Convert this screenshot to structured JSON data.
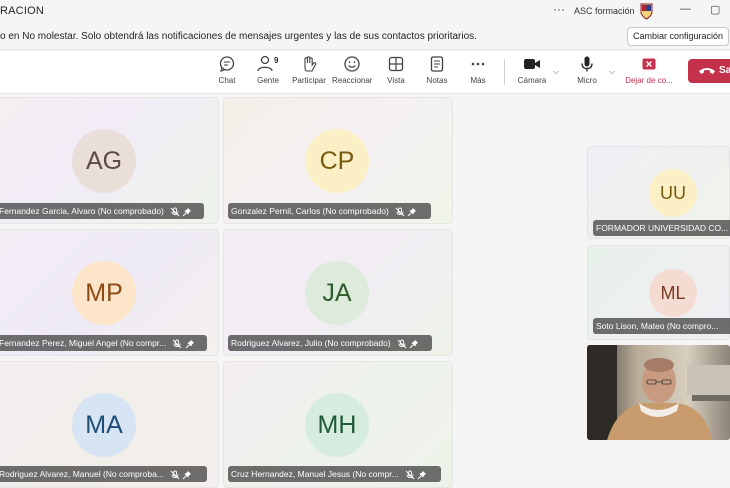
{
  "window": {
    "title": "RACION",
    "org_name": "ASC formación",
    "more_label": "···"
  },
  "notification": {
    "message": "o en No molestar. Solo obtendrá las notificaciones de mensajes urgentes y las de sus contactos prioritarios.",
    "button_label": "Cambiar configuración"
  },
  "toolbar": {
    "chat": "Chat",
    "people": "Gente",
    "people_count": "9",
    "raise": "Participar",
    "react": "Reaccionar",
    "view": "Vista",
    "notes": "Notas",
    "more": "Más",
    "camera": "Cámara",
    "mic": "Micro",
    "leave": "Dejar de co...",
    "hangup": "Sa"
  },
  "participants": [
    {
      "initials": "AG",
      "name": "Fernandez Garcia, Alvaro (No comprobado)",
      "avatar_bg": "#eaded9",
      "avatar_fg": "#5a4a42"
    },
    {
      "initials": "CP",
      "name": "Gonzalez Pernil, Carlos (No comprobado)",
      "avatar_bg": "#fbefc6",
      "avatar_fg": "#7a5a10"
    },
    {
      "initials": "MP",
      "name": "Fernandez Perez, Miguel Angel (No compr...",
      "avatar_bg": "#fde5c9",
      "avatar_fg": "#8a4a12"
    },
    {
      "initials": "JA",
      "name": "Rodriguez Alvarez, Julio (No comprobado)",
      "avatar_bg": "#dcebdc",
      "avatar_fg": "#2e5a2e"
    },
    {
      "initials": "MA",
      "name": "Rodriguez Alvarez, Manuel (No comproba...",
      "avatar_bg": "#d7e4f3",
      "avatar_fg": "#1f4e79"
    },
    {
      "initials": "MH",
      "name": "Cruz Hernandez, Manuel Jesus (No compr...",
      "avatar_bg": "#d6ecdf",
      "avatar_fg": "#1e5a3a"
    }
  ],
  "side_participants": [
    {
      "initials": "UU",
      "name": "FORMADOR UNIVERSIDAD CO...",
      "avatar_bg": "#fbefc6",
      "avatar_fg": "#7a5a10"
    },
    {
      "initials": "ML",
      "name": "Soto Lison, Mateo (No compro...",
      "avatar_bg": "#f5dcd2",
      "avatar_fg": "#7a3a24"
    }
  ],
  "icons": [
    "chat-icon",
    "people-icon",
    "raise-hand-icon",
    "smiley-icon",
    "grid-view-icon",
    "notes-icon",
    "more-icon",
    "camera-icon",
    "microphone-icon",
    "leave-icon",
    "phone-hangup-icon",
    "mic-off-icon",
    "pin-icon"
  ],
  "colors": {
    "hangup": "#c4314b",
    "accent": "#5b5fc7"
  }
}
